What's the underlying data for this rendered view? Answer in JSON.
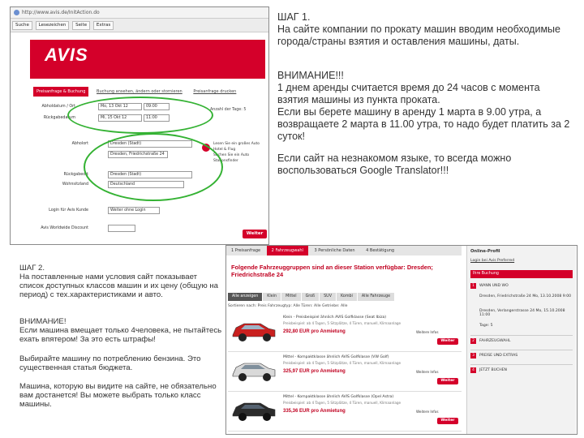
{
  "step1": {
    "heading": "ШАГ 1.",
    "text": "На сайте компании по прокату машин вводим необходимые города/страны взятия и оставления машины, даты.",
    "warning": "ВНИМАНИЕ!!!\n1 днем аренды считается время до 24 часов с момента взятия машины из пункта проката.\nЕсли вы берете машину в аренду 1 марта в 9.00 утра, а возвращаете 2 марта в 11.00 утра, то надо будет платить за 2 суток!",
    "tip": "Если сайт на незнакомом языке, то всегда можно воспользоваться Google Translator!!!"
  },
  "step2": {
    "heading": "ШАГ 2.",
    "text": "На поставленные нами условия сайт показывает список доступных классов машин и их цену (общую на период) с тех.характеристиками и авто.",
    "warning": "ВНИМАНИЕ!\nЕсли машина вмещает только 4человека, не пытайтесь ехать впятером! За это есть штрафы!",
    "fuel": "Выбирайте машину по потреблению бензина. Это существенная статья бюджета.",
    "note": "Машина, которую вы видите на сайте, не обязательно вам достанется! Вы можете выбрать только класс машины."
  },
  "shot1": {
    "address": "http://www.avis.de/InitAction.do",
    "toolbar": [
      "Suche",
      "Lesezeichen",
      "Seite",
      "Extras"
    ],
    "logo": "AVIS",
    "tabs": [
      "Preisanfrage & Buchung",
      "Buchung ansehen, ändern oder stornieren",
      "Preisanfrage drucken"
    ],
    "form": {
      "pickup_date_label": "Abholdatum / Ort",
      "pickup_date": "Mo, 13 Okt 12",
      "return_date_label": "Rückgabedatum",
      "return_date": "Mi, 15 Okt 12",
      "days_label": "Anzahl der Tage: 5",
      "pickup_place_label": "Abholort",
      "pickup_place": "Dresden (Stadt)",
      "pickup_station": "Dresden, Friedrichstraße 24",
      "return_place_label": "Rückgabeort",
      "return_place": "Dresden (Stadt)",
      "country_label": "Wohnsitzland",
      "country": "Deutschland",
      "promo_label": "Login für Avis Kunde",
      "promo": "Weiter ohne Login",
      "discount_label": "Avis Worldwide Discount",
      "side_links": [
        "Lesen Sie ein großes Auto",
        "Hotel & Flug",
        "Suchen Sie ein Auto",
        "Stationsfinder"
      ]
    },
    "weiter": "Weiter"
  },
  "shot2": {
    "steps": [
      "1 Preisanfrage",
      "2 Fahrzeugwahl",
      "3 Persönliche Daten",
      "4 Bestätigung"
    ],
    "heading": "Folgende Fahrzeuggruppen sind an dieser Station verfügbar: Dresden; Friedrichstraße 24",
    "cat_tabs": [
      "Alle anzeigen",
      "Klein",
      "Mittel",
      "Groß",
      "SUV",
      "Kombi",
      "Alle Fahrzeuge"
    ],
    "filter": "Sortieren nach: Preis   Fahrzeugtyp: Alle   Türen: Alle   Getriebe: Alle",
    "cars": [
      {
        "title": "Klein - Preisbeispiel ähnlich AVIS Golfklasse (Seat Ibiza)",
        "sub": "Preisbeispiel: ab 4 Tagen, 5 Sitzplätze, 4 Türen, manuell, Klimaanlage",
        "price": "292,80 EUR pro Anmietung",
        "info": "Weitere Infos",
        "weiter": "Weiter",
        "color": "#c9201f"
      },
      {
        "title": "Mittel - Kompaktklasse ähnlich AVIS Golfklasse (VW Golf)",
        "sub": "Preisbeispiel: ab 4 Tagen, 5 Sitzplätze, 4 Türen, manuell, Klimaanlage",
        "price": "325,97 EUR pro Anmietung",
        "info": "Weitere Infos",
        "weiter": "Weiter",
        "color": "#d9d9d9"
      },
      {
        "title": "Mittel - Kompaktklasse ähnlich AVIS Golfklasse (Opel Astra)",
        "sub": "Preisbeispiel: ab 4 Tagen, 5 Sitzplätze, 4 Türen, manuell, Klimaanlage",
        "price": "335,36 EUR pro Anmietung",
        "info": "Weitere Infos",
        "weiter": "Weiter",
        "color": "#2b2b2b"
      }
    ],
    "side": {
      "title": "Online-Profil",
      "profile_link": "Login bei Avis   Preferred",
      "bar": "Ihre Buchung",
      "items": [
        {
          "num": "1",
          "text": "WANN UND WO"
        },
        {
          "num": "",
          "text": "Dresden, Friedrichstraße 24 Mo, 13.10.2008 9:00"
        },
        {
          "num": "",
          "text": "Dresden, Verlangerstrasse 24 Mo, 15.10.2008 11:00"
        },
        {
          "num": "",
          "text": "Tage: 5"
        },
        {
          "num": "2",
          "text": "FAHRZEUGWAHL"
        },
        {
          "num": "3",
          "text": "PREISE UND EXTRAS"
        },
        {
          "num": "4",
          "text": "JETZT BUCHEN"
        }
      ]
    }
  }
}
